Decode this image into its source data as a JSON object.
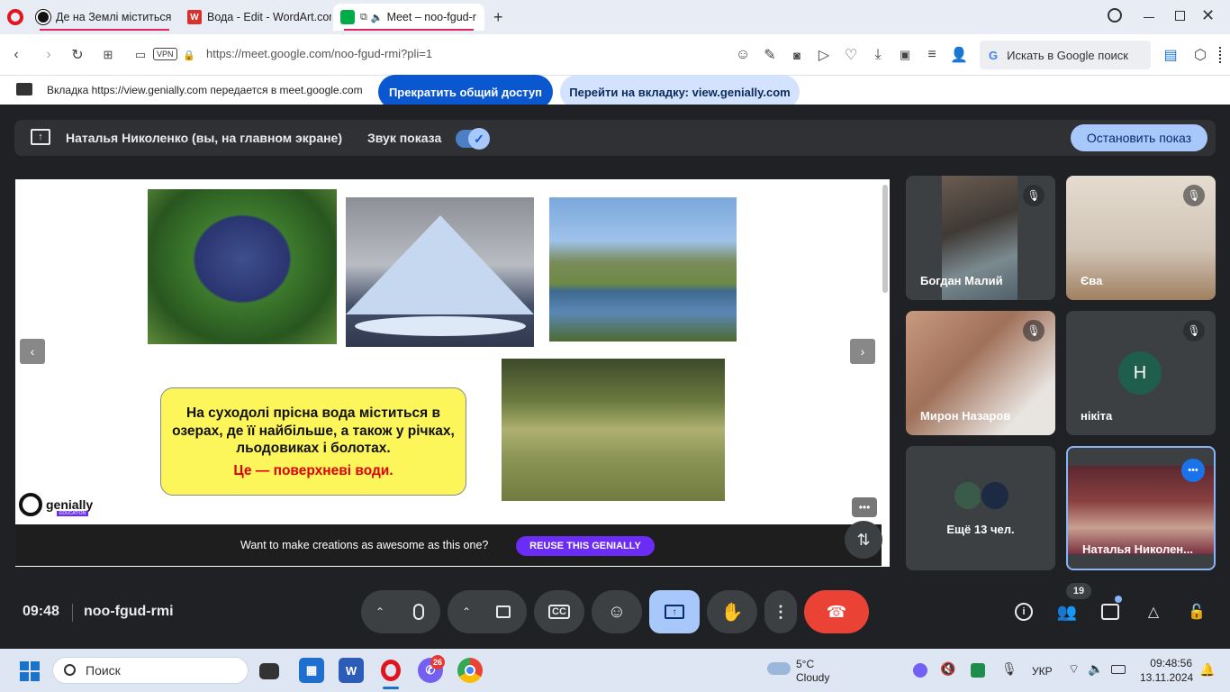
{
  "browser": {
    "tabs": [
      {
        "title": "Де на Землі міститься вод",
        "favicon": "genially-icon"
      },
      {
        "title": "Вода - Edit - WordArt.com",
        "favicon": "wordart-icon"
      },
      {
        "title": "Meet – noo-fgud-r",
        "favicon": "meet-icon"
      }
    ],
    "url": "https://meet.google.com/noo-fgud-rmi?pli=1",
    "vpn_label": "VPN",
    "search_placeholder": "Искать в Google поиск"
  },
  "share_banner": {
    "text": "Вкладка https://view.genially.com передается в meet.google.com",
    "stop_button": "Прекратить общий доступ",
    "goto_button": "Перейти на вкладку: view.genially.com"
  },
  "presenting": {
    "presenter": "Наталья Николенко (вы, на главном экране)",
    "audio_label": "Звук показа",
    "audio_on": true,
    "stop_button": "Остановить показ"
  },
  "slide": {
    "text_main": "На суходолі прісна вода міститься в озерах, де її найбільше, а також у річках, льодовиках і болотах.",
    "text_red": "Це — поверхневі води.",
    "logo_text": "genially",
    "logo_sub": "EDUCATION",
    "banner_text": "Want to make creations as awesome as this one?",
    "reuse_button": "REUSE THIS GENIALLY",
    "images": [
      "lake",
      "iceberg",
      "river",
      "swamp"
    ]
  },
  "participants": [
    {
      "name": "Богдан Малий",
      "muted": true
    },
    {
      "name": "Єва",
      "muted": true
    },
    {
      "name": "Мирон Назаров",
      "muted": true
    },
    {
      "name": "нікіта",
      "muted": true,
      "initial": "Н",
      "avatar_color": "#1e5e4a"
    },
    {
      "name": "Ещё 13 чел."
    },
    {
      "name": "Наталья Николен...",
      "self": true
    }
  ],
  "meeting": {
    "time": "09:48",
    "code": "noo-fgud-rmi",
    "participant_count": "19"
  },
  "taskbar": {
    "search": "Поиск",
    "badge": "26",
    "weather_temp": "5°C",
    "weather_desc": "Cloudy",
    "lang": "УКР",
    "time": "09:48:56",
    "date": "13.11.2024"
  }
}
